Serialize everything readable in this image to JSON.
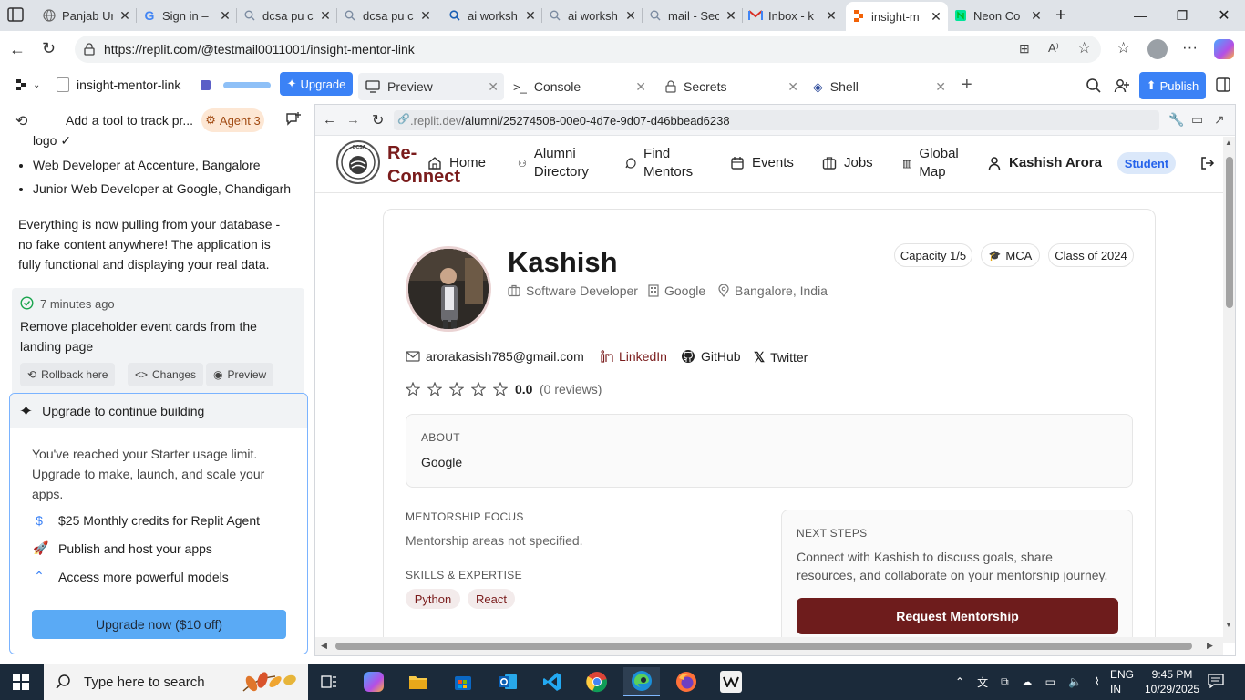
{
  "browser": {
    "tabs": [
      {
        "title": "Panjab Ur",
        "icon": "globe-icon"
      },
      {
        "title": "Sign in –",
        "icon": "google-icon"
      },
      {
        "title": "dcsa pu c",
        "icon": "search-icon"
      },
      {
        "title": "dcsa pu c",
        "icon": "search-icon"
      },
      {
        "title": "ai worksh",
        "icon": "search-icon"
      },
      {
        "title": "ai worksh",
        "icon": "search-icon"
      },
      {
        "title": "mail - Sec",
        "icon": "search-icon"
      },
      {
        "title": "Inbox - k",
        "icon": "gmail-icon"
      },
      {
        "title": "insight-m",
        "icon": "replit-icon"
      },
      {
        "title": "Neon Co",
        "icon": "neon-icon"
      }
    ],
    "url": "https://replit.com/@testmail0011001/insight-mentor-link"
  },
  "replit": {
    "project_name": "insight-mentor-link",
    "upgrade_label": "Upgrade",
    "tabs": [
      "Preview",
      "Console",
      "Secrets",
      "Shell"
    ],
    "publish_label": "Publish"
  },
  "agent": {
    "thread_title": "Add a tool to track pr...",
    "agent_badge": "Agent 3",
    "logo_line": "logo ✓",
    "bullets": [
      "Web Developer at Accenture, Bangalore",
      "Junior Web Developer at Google, Chandigarh"
    ],
    "summary": "Everything is now pulling from your database - no fake content anywhere! The application is fully functional and displaying your real data.",
    "checkpoint_time": "7 minutes ago",
    "checkpoint_text": "Remove placeholder event cards from the landing page",
    "rollback_label": "Rollback here",
    "changes_label": "Changes",
    "preview_label": "Preview",
    "upgrade_card": {
      "title": "Upgrade to continue building",
      "body": "You've reached your Starter usage limit. Upgrade to make, launch, and scale your apps.",
      "features": [
        {
          "icon": "dollar-icon",
          "text": "$25 Monthly credits for Replit Agent"
        },
        {
          "icon": "rocket-icon",
          "text": "Publish and host your apps"
        },
        {
          "icon": "chevrons-up-icon",
          "text": "Access more powerful models"
        }
      ],
      "button": "Upgrade now ($10 off)"
    }
  },
  "preview": {
    "url_prefix": ".replit.dev",
    "url_path": "/alumni/25274508-00e0-4d7e-9d07-d46bbead6238"
  },
  "site": {
    "brand_line1": "Re-",
    "brand_line2": "Connect",
    "logo_text": "DCSA",
    "nav": [
      {
        "icon": "home-icon",
        "label": "Home"
      },
      {
        "icon": "users-icon",
        "label": "Alumni Directory"
      },
      {
        "icon": "message-icon",
        "label": "Find Mentors"
      },
      {
        "icon": "calendar-icon",
        "label": "Events"
      },
      {
        "icon": "briefcase-icon",
        "label": "Jobs"
      },
      {
        "icon": "map-icon",
        "label": "Global Map"
      }
    ],
    "user_name": "Kashish Arora",
    "role_badge": "Student",
    "colors": {
      "accent": "#7a1c1c",
      "link": "#7a1c1c",
      "badge_bg": "#dbe8fa"
    }
  },
  "profile": {
    "name": "Kashish",
    "pills": [
      "Capacity 1/5",
      "MCA",
      "Class of 2024"
    ],
    "role": "Software Developer",
    "company": "Google",
    "location": "Bangalore, India",
    "email": "arorakasish785@gmail.com",
    "linkedin": "LinkedIn",
    "github": "GitHub",
    "twitter": "Twitter",
    "rating": "0.0",
    "reviews": "(0 reviews)",
    "rating_value": 0,
    "about_label": "ABOUT",
    "about_text": "Google",
    "focus_label": "MENTORSHIP FOCUS",
    "focus_text": "Mentorship areas not specified.",
    "skills_label": "SKILLS & EXPERTISE",
    "skills": [
      "Python",
      "React"
    ],
    "next_label": "NEXT STEPS",
    "next_text": "Connect with Kashish to discuss goals, share resources, and collaborate on your mentorship journey.",
    "request_btn": "Request Mentorship"
  },
  "taskbar": {
    "search_placeholder": "Type here to search",
    "lang_line1": "ENG",
    "lang_line2": "IN",
    "time": "9:45 PM",
    "date": "10/29/2025"
  }
}
